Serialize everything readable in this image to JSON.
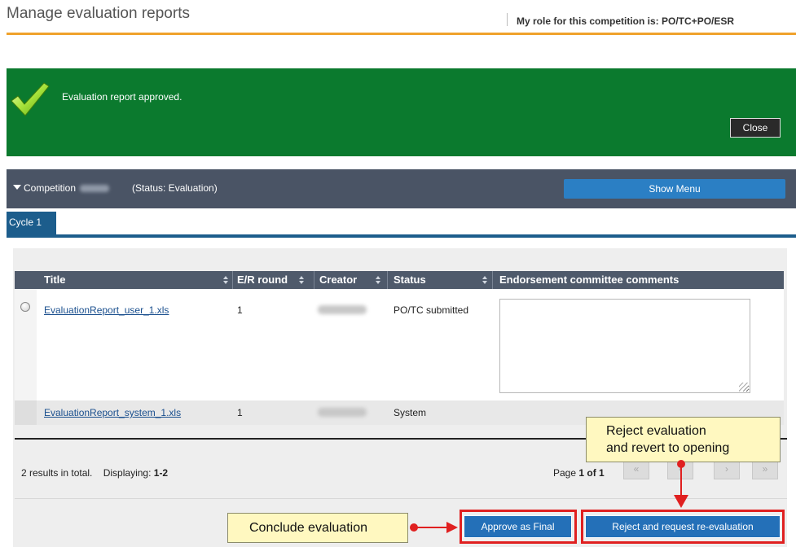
{
  "header": {
    "title": "Manage evaluation reports",
    "role_text": "My role for this competition is: PO/TC+PO/ESR"
  },
  "notification": {
    "message": "Evaluation report approved.",
    "close_label": "Close",
    "icon": "checkmark-icon",
    "background_color": "#0b7a2e"
  },
  "competition": {
    "prefix": "Competition",
    "status": "(Status: Evaluation)",
    "show_menu_label": "Show Menu"
  },
  "tabs": [
    {
      "label": "Cycle 1",
      "active": true
    }
  ],
  "table": {
    "columns": [
      "Title",
      "E/R round",
      "Creator",
      "Status",
      "Endorsement committee comments"
    ],
    "rows": [
      {
        "title": "EvaluationReport_user_1.xls",
        "round": "1",
        "status": "PO/TC submitted",
        "comments": ""
      },
      {
        "title": "EvaluationReport_system_1.xls",
        "round": "1",
        "status": "System",
        "comments": ""
      }
    ]
  },
  "pagination": {
    "total_text": "2 results in total.",
    "displaying_label": "Displaying:",
    "displaying_range": "1-2",
    "page_label": "Page",
    "page_current": "1 of 1",
    "buttons": [
      "«",
      "‹",
      "›",
      "»"
    ]
  },
  "actions": {
    "approve_label": "Approve as Final",
    "reject_label": "Reject and request re-evaluation"
  },
  "callouts": {
    "conclude": "Conclude evaluation",
    "reject_line1": "Reject evaluation",
    "reject_line2": "and revert to opening"
  },
  "colors": {
    "accent_orange": "#f0a22c",
    "header_bar": "#4a5465",
    "button_blue": "#2470b8",
    "annotation_red": "#e02020"
  }
}
